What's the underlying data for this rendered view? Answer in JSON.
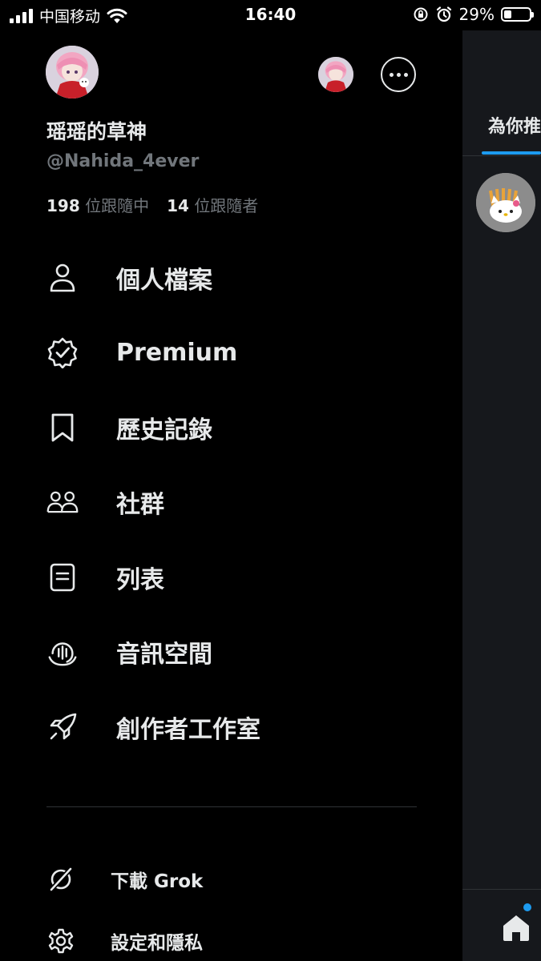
{
  "status_bar": {
    "carrier": "中国移动",
    "time": "16:40",
    "battery_percent": "29%",
    "battery_level": 0.29
  },
  "timeline": {
    "tab_label": "為你推",
    "accent_color": "#1d9bf0"
  },
  "profile": {
    "display_name": "瑶瑶的草神",
    "handle": "@Nahida_4ever",
    "following_count": "198",
    "following_label": "位跟隨中",
    "followers_count": "14",
    "followers_label": "位跟隨者"
  },
  "menu": {
    "items": [
      {
        "label": "個人檔案",
        "icon": "person-icon"
      },
      {
        "label": "Premium",
        "icon": "verified-badge-icon"
      },
      {
        "label": "歷史記錄",
        "icon": "bookmark-icon"
      },
      {
        "label": "社群",
        "icon": "communities-icon"
      },
      {
        "label": "列表",
        "icon": "list-icon"
      },
      {
        "label": "音訊空間",
        "icon": "spaces-icon"
      },
      {
        "label": "創作者工作室",
        "icon": "rocket-icon"
      }
    ]
  },
  "secondary": {
    "grok_label": "下載 Grok",
    "settings_label": "設定和隱私"
  },
  "colors": {
    "background": "#000000",
    "text_primary": "#e7e9ea",
    "text_secondary": "#71767b",
    "divider": "#2f3336"
  }
}
